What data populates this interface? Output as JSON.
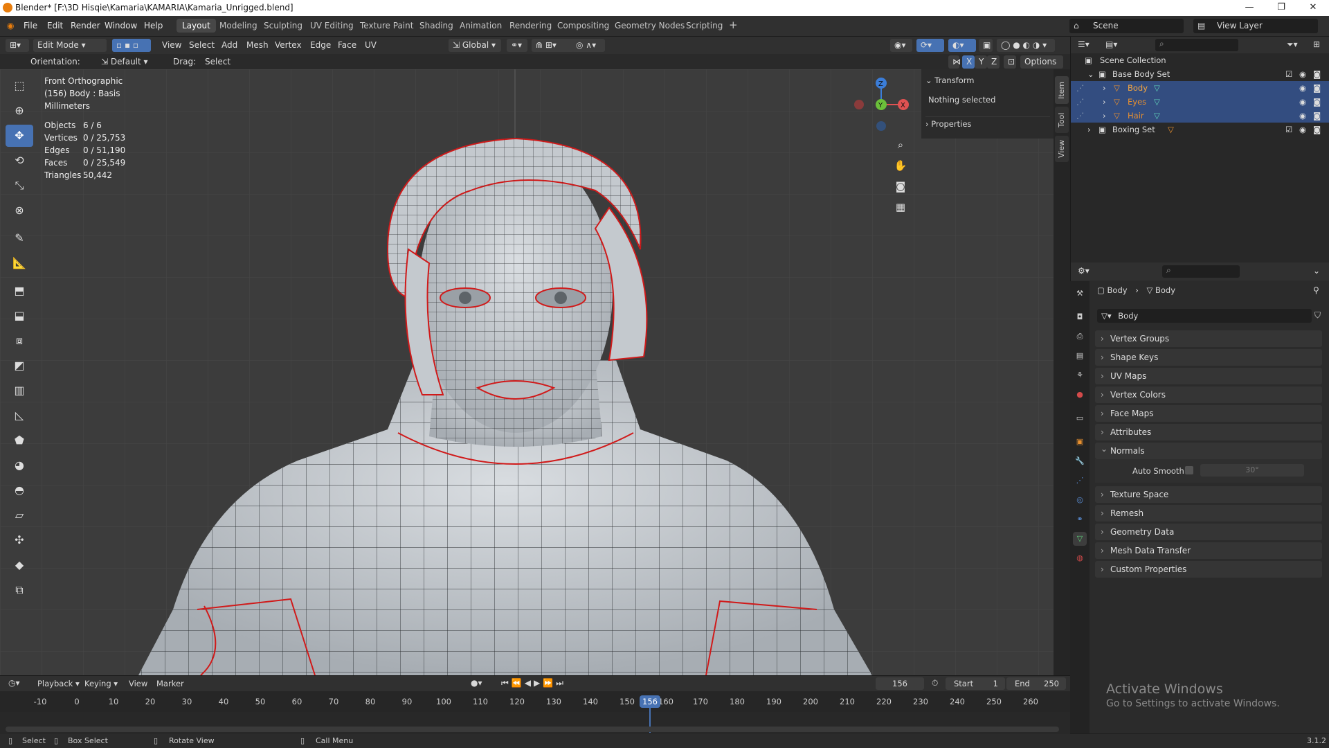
{
  "window": {
    "title": "Blender* [F:\\3D Hisqie\\Kamaria\\KAMARIA\\Kamaria_Unrigged.blend]",
    "minimize": "—",
    "restore": "❐",
    "close": "✕"
  },
  "menu": {
    "items": [
      "File",
      "Edit",
      "Render",
      "Window",
      "Help"
    ]
  },
  "workspaces": {
    "tabs": [
      "Layout",
      "Modeling",
      "Sculpting",
      "UV Editing",
      "Texture Paint",
      "Shading",
      "Animation",
      "Rendering",
      "Compositing",
      "Geometry Nodes",
      "Scripting"
    ],
    "active": "Layout",
    "add": "+"
  },
  "scene": {
    "label": "Scene",
    "view_layer": "View Layer"
  },
  "header3d": {
    "mode": "Edit Mode",
    "menus": [
      "View",
      "Select",
      "Add",
      "Mesh",
      "Vertex",
      "Edge",
      "Face",
      "UV"
    ],
    "transform_orientation": "Global"
  },
  "header3d_row2": {
    "orientation_label": "Orientation:",
    "orientation_value": "Default",
    "drag_label": "Drag:",
    "drag_value": "Select Box",
    "options": "Options",
    "axes": [
      "X",
      "Y",
      "Z"
    ]
  },
  "viewport": {
    "view_name": "Front Orthographic",
    "object_info": "(156) Body : Basis",
    "units": "Millimeters",
    "stats": [
      {
        "label": "Objects",
        "value": "6 / 6"
      },
      {
        "label": "Vertices",
        "value": "0 / 25,753"
      },
      {
        "label": "Edges",
        "value": "0 / 51,190"
      },
      {
        "label": "Faces",
        "value": "0 / 25,549"
      },
      {
        "label": "Triangles",
        "value": "50,442"
      }
    ],
    "gizmo": {
      "x": "X",
      "y": "Y",
      "z": "Z"
    }
  },
  "npanel": {
    "transform": "Transform",
    "nothing_selected": "Nothing selected",
    "properties": "Properties",
    "tabs": [
      "Item",
      "Tool",
      "View"
    ]
  },
  "outliner": {
    "root": "Scene Collection",
    "rows": [
      {
        "name": "Base Body Set",
        "indent": 1,
        "type": "collection",
        "selected": false
      },
      {
        "name": "Body",
        "indent": 2,
        "type": "mesh",
        "selected": true
      },
      {
        "name": "Eyes",
        "indent": 2,
        "type": "mesh",
        "selected": true
      },
      {
        "name": "Hair",
        "indent": 2,
        "type": "mesh",
        "selected": true
      },
      {
        "name": "Boxing Set",
        "indent": 1,
        "type": "collection",
        "selected": false
      }
    ]
  },
  "properties": {
    "breadcrumb_object": "Body",
    "breadcrumb_data": "Body",
    "data_name": "Body",
    "panels": [
      "Vertex Groups",
      "Shape Keys",
      "UV Maps",
      "Vertex Colors",
      "Face Maps",
      "Attributes",
      "Normals",
      "Texture Space",
      "Remesh",
      "Geometry Data",
      "Mesh Data Transfer",
      "Custom Properties"
    ],
    "auto_smooth_label": "Auto Smooth",
    "auto_smooth_angle": "30°"
  },
  "timeline": {
    "menus": [
      "Playback",
      "Keying",
      "View",
      "Marker"
    ],
    "current_frame": "156",
    "start_label": "Start",
    "start": "1",
    "end_label": "End",
    "end": "250",
    "ticks": [
      "-10",
      "0",
      "10",
      "20",
      "30",
      "40",
      "50",
      "60",
      "70",
      "80",
      "90",
      "100",
      "110",
      "120",
      "130",
      "140",
      "150",
      "160",
      "170",
      "180",
      "190",
      "200",
      "210",
      "220",
      "230",
      "240",
      "250",
      "260"
    ]
  },
  "statusbar": {
    "select": "Select",
    "box_select": "Box Select",
    "rotate_view": "Rotate View",
    "call_menu": "Call Menu",
    "version": "3.1.2"
  },
  "watermark": {
    "line1": "Activate Windows",
    "line2": "Go to Settings to activate Windows."
  },
  "colors": {
    "accent": "#4772b3",
    "seam": "#d01a1a",
    "selection": "#334d80",
    "orange": "#e87d0d"
  }
}
